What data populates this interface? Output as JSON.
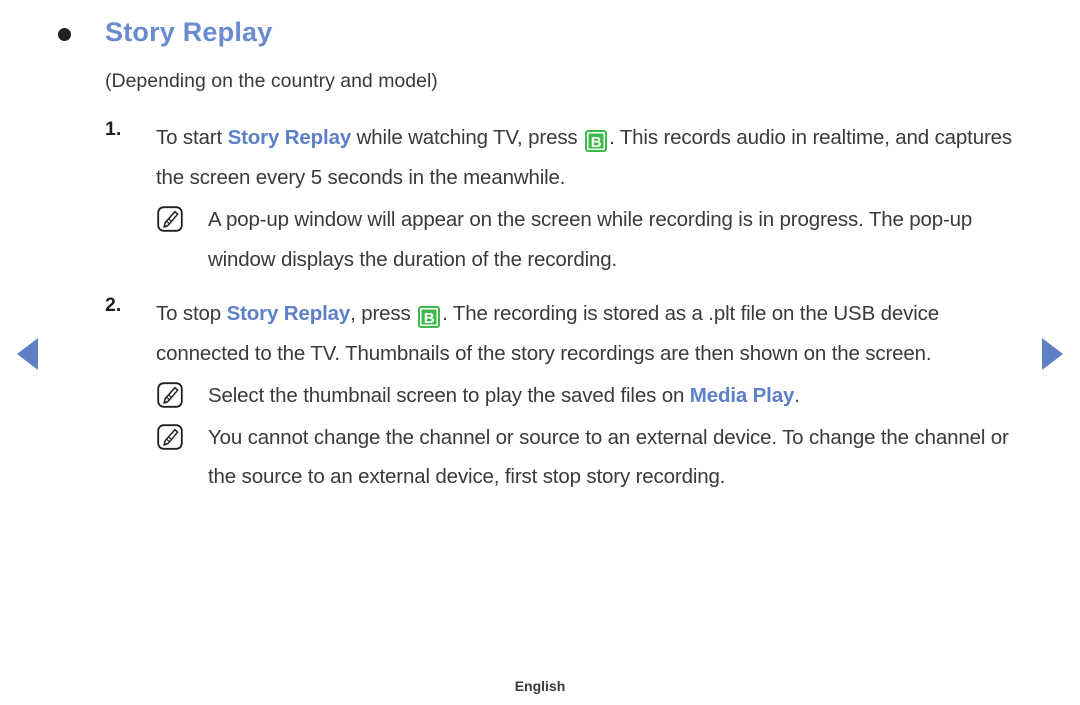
{
  "nav": {
    "prev_label": "Previous page",
    "next_label": "Next page"
  },
  "heading": {
    "title": "Story Replay",
    "bullet_icon": "bullet-dot-icon"
  },
  "subnote": "(Depending on the country and model)",
  "keys": {
    "b_button": "B"
  },
  "steps": [
    {
      "number": "1.",
      "text_parts": {
        "p1": "To start ",
        "kw1": "Story Replay",
        "p2": " while watching TV, press ",
        "p3": ". This records audio in realtime, and captures the screen every 5 seconds in the meanwhile."
      },
      "notes": [
        {
          "icon": "note-pencil-icon",
          "text": "A pop-up window will appear on the screen while recording is in progress. The pop-up window displays the duration of the recording."
        }
      ]
    },
    {
      "number": "2.",
      "text_parts": {
        "p1": "To stop ",
        "kw1": "Story Replay",
        "p2": ", press ",
        "p3": ". The recording is stored as a .plt file on the USB device connected to the TV. Thumbnails of the story recordings are then shown on the screen."
      },
      "notes": [
        {
          "icon": "note-pencil-icon",
          "text_p1": "Select the thumbnail screen to play the saved files on ",
          "kw": "Media Play",
          "text_p2": "."
        },
        {
          "icon": "note-pencil-icon",
          "text": "You cannot change the channel or source to an external device. To change the channel or the source to an external device, first stop story recording."
        }
      ]
    }
  ],
  "footer": {
    "language": "English"
  },
  "colors": {
    "accent_blue": "#5d80c8",
    "heading_blue": "#6a8bd0",
    "key_green": "#3cbb4b",
    "arrow_blue": "#5d7fc4",
    "body_text": "#3a3a3a"
  }
}
